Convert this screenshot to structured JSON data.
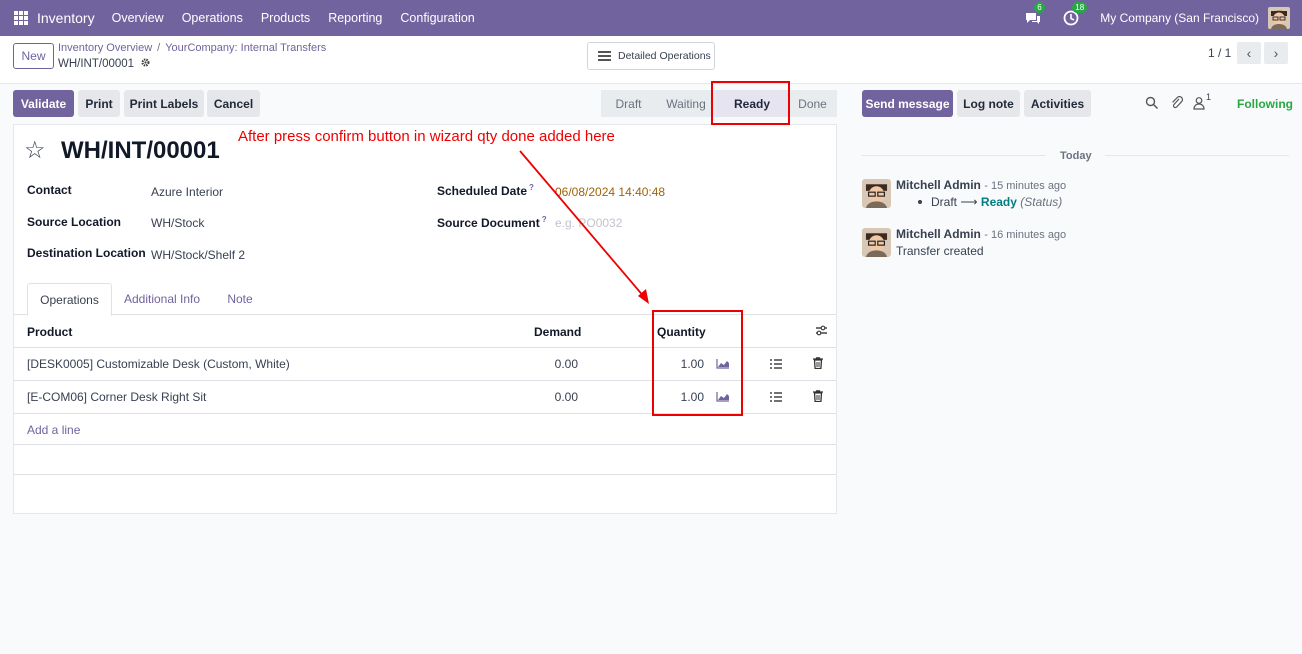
{
  "navbar": {
    "app_name": "Inventory",
    "menu": [
      "Overview",
      "Operations",
      "Products",
      "Reporting",
      "Configuration"
    ],
    "messages_count": "6",
    "activities_count": "18",
    "company": "My Company (San Francisco)"
  },
  "control": {
    "new_label": "New",
    "breadcrumb": [
      "Inventory Overview",
      "YourCompany: Internal Transfers"
    ],
    "breadcrumb_sep": "/",
    "record": "WH/INT/00001",
    "detailed_ops_label": "Detailed Operations",
    "pager": "1 / 1"
  },
  "actions": {
    "validate": "Validate",
    "print": "Print",
    "print_labels": "Print Labels",
    "cancel": "Cancel"
  },
  "status": {
    "stages": [
      "Draft",
      "Waiting",
      "Ready",
      "Done"
    ],
    "active": "Ready"
  },
  "form": {
    "title": "WH/INT/00001",
    "contact_label": "Contact",
    "contact": "Azure Interior",
    "source_location_label": "Source Location",
    "source_location": "WH/Stock",
    "destination_location_label": "Destination Location",
    "destination_location": "WH/Stock/Shelf 2",
    "scheduled_date_label": "Scheduled Date",
    "scheduled_date": "06/08/2024 14:40:48",
    "source_document_label": "Source Document",
    "source_document_placeholder": "e.g. PO0032",
    "help_mark": "?",
    "tabs": [
      "Operations",
      "Additional Info",
      "Note"
    ],
    "columns": {
      "product": "Product",
      "demand": "Demand",
      "quantity": "Quantity"
    },
    "lines": [
      {
        "product": "[DESK0005] Customizable Desk (Custom, White)",
        "demand": "0.00",
        "quantity": "1.00"
      },
      {
        "product": "[E-COM06] Corner Desk Right Sit",
        "demand": "0.00",
        "quantity": "1.00"
      }
    ],
    "add_line": "Add a line"
  },
  "chatter": {
    "send_message": "Send message",
    "log_note": "Log note",
    "activities": "Activities",
    "followers_count": "1",
    "following": "Following",
    "date_separator": "Today",
    "messages": [
      {
        "author": "Mitchell Admin",
        "time": "- 15 minutes ago",
        "from": "Draft",
        "arrow": "⟶",
        "to": "Ready",
        "field": "(Status)"
      },
      {
        "author": "Mitchell Admin",
        "time": "- 16 minutes ago",
        "body": "Transfer created"
      }
    ]
  },
  "annotation": {
    "text": "After  press confirm button in wizard qty done added here"
  },
  "colors": {
    "brand": "#71639e",
    "annotation": "#ee0000",
    "following": "#28a745",
    "date": "#a16207"
  }
}
